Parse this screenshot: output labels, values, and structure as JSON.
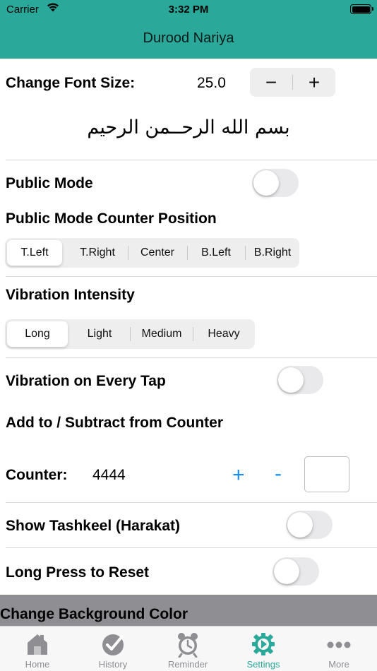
{
  "status_bar": {
    "carrier": "Carrier",
    "time": "3:32 PM"
  },
  "nav": {
    "title": "Durood Nariya"
  },
  "font_size": {
    "label": "Change Font Size:",
    "value": "25.0",
    "decrement": "−",
    "increment": "+"
  },
  "preview_text": "بسم الله الرحــمن الرحيم",
  "public_mode": {
    "label": "Public Mode",
    "enabled": false
  },
  "counter_position": {
    "label": "Public Mode Counter Position",
    "options": [
      "T.Left",
      "T.Right",
      "Center",
      "B.Left",
      "B.Right"
    ],
    "selected": "T.Left"
  },
  "vibration_intensity": {
    "label": "Vibration Intensity",
    "options": [
      "Long",
      "Light",
      "Medium",
      "Heavy"
    ],
    "selected": "Long"
  },
  "vibration_every_tap": {
    "label": "Vibration on Every Tap",
    "enabled": false
  },
  "add_subtract": {
    "label": "Add to / Subtract from Counter"
  },
  "counter": {
    "label": "Counter:",
    "value": "4444",
    "plus": "+",
    "minus": "-",
    "input_value": ""
  },
  "show_tashkeel": {
    "label": "Show Tashkeel (Harakat)",
    "enabled": false
  },
  "long_press_reset": {
    "label": "Long Press to Reset",
    "enabled": false
  },
  "background_color": {
    "label": "Change Background Color"
  },
  "tabs": [
    {
      "label": "Home",
      "icon": "home-icon"
    },
    {
      "label": "History",
      "icon": "checkmark-badge-icon"
    },
    {
      "label": "Reminder",
      "icon": "alarm-clock-icon"
    },
    {
      "label": "Settings",
      "icon": "gear-icon",
      "active": true
    },
    {
      "label": "More",
      "icon": "more-dots-icon"
    }
  ],
  "colors": {
    "accent": "#2aa99a",
    "link_blue": "#1a8cf0",
    "tab_inactive": "#8e8e93"
  }
}
